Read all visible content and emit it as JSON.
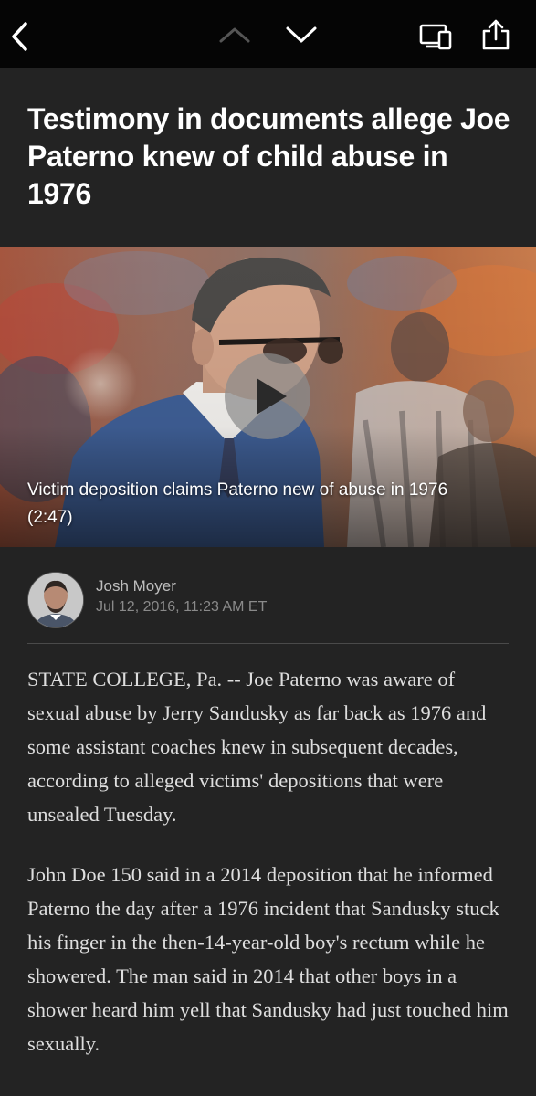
{
  "toolbar": {
    "back_icon": "chevron-left-icon",
    "prev_icon": "chevron-up-icon",
    "next_icon": "chevron-down-icon",
    "device_icon": "devices-icon",
    "share_icon": "share-icon"
  },
  "article": {
    "headline": "Testimony in documents allege Joe Paterno knew of child abuse in 1976",
    "video": {
      "caption": "Victim deposition claims Paterno new of abuse in 1976 (2:47)",
      "play_icon": "play-icon"
    },
    "author": {
      "name": "Josh Moyer",
      "date": "Jul 12, 2016, 11:23 AM ET"
    },
    "paragraphs": [
      "STATE COLLEGE, Pa. -- Joe Paterno was aware of sexual abuse by Jerry Sandusky as far back as 1976 and some assistant coaches knew in subsequent decades, according to alleged victims' depositions that were unsealed Tuesday.",
      "John Doe 150 said in a 2014 deposition that he informed Paterno the day after a 1976 incident that Sandusky stuck his finger in the then-14-year-old boy's rectum while he showered. The man said in 2014 that other boys in a shower heard him yell that Sandusky had just touched him sexually."
    ]
  },
  "colors": {
    "toolbar_bg": "#050505",
    "page_bg": "#232323",
    "headline": "#ffffff",
    "body_text": "#dedede"
  }
}
